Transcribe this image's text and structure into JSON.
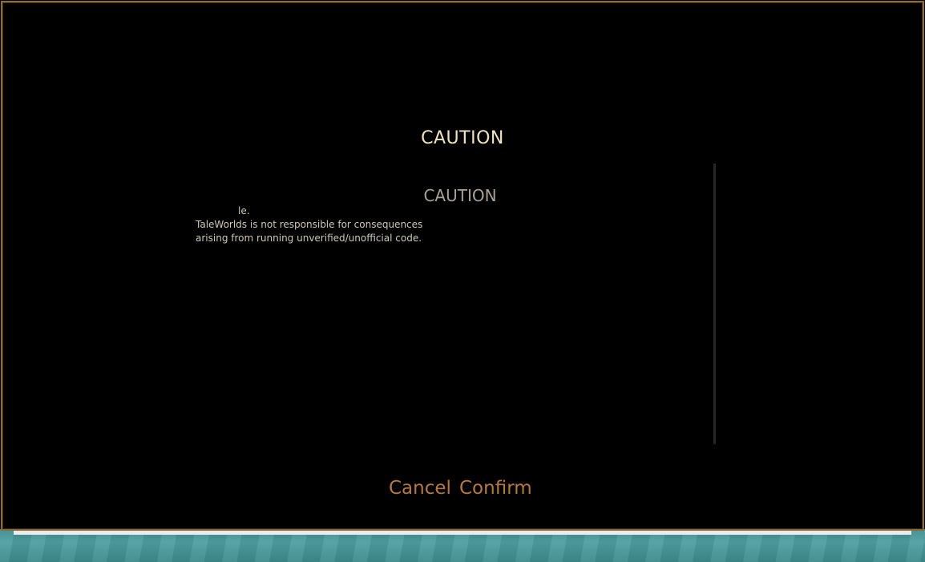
{
  "dialog": {
    "title": "CAUTION",
    "inner_title": "CAUTION",
    "message_lines": [
      "le.",
      "TaleWorlds is not responsible for consequences",
      "arising from running unverified/unofficial code."
    ],
    "buttons": {
      "cancel_label": "Cancel",
      "confirm_label": "Confirm"
    }
  },
  "colors": {
    "frame_border": "#8a6c3e",
    "title": "#f0e3c4",
    "button_text": "#b57842",
    "body_text": "#cfc8ba"
  }
}
